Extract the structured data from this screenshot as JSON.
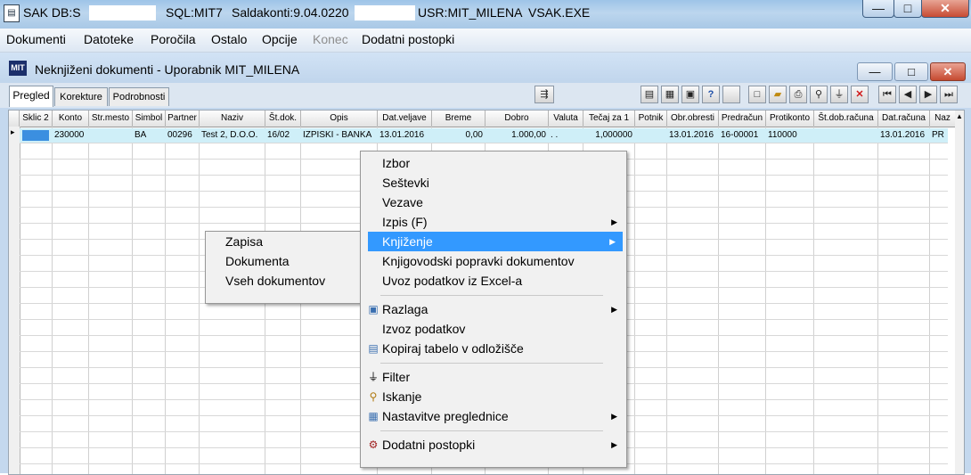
{
  "window": {
    "title_prefix": "SAK   DB:S",
    "title_sql": "SQL:MIT7",
    "title_saldo": "Saldakonti:9.04.0220",
    "title_usr": "USR:MIT_MILENA",
    "title_exe": "VSAK.EXE",
    "minimize": "—",
    "maximize": "□",
    "close": "✕"
  },
  "menubar": [
    "Dokumenti",
    "Datoteke",
    "Poročila",
    "Ostalo",
    "Opcije",
    "Konec",
    "Dodatni postopki"
  ],
  "inner_window": {
    "icon_text": "MIT",
    "title": "Neknjiženi dokumenti - Uporabnik MIT_MILENA"
  },
  "tabs": [
    "Pregled",
    "Korekture",
    "Podrobnosti"
  ],
  "grid": {
    "columns": [
      "Sklic 2",
      "Konto",
      "Str.mesto",
      "Simbol",
      "Partner",
      "Naziv",
      "Št.dok.",
      "Opis",
      "Dat.veljave",
      "Breme",
      "Dobro",
      "Valuta",
      "Tečaj za 1",
      "Potnik",
      "Obr.obresti",
      "Predračun",
      "Protikonto",
      "Št.dob.računa",
      "Dat.računa",
      "Naz"
    ],
    "row": [
      "",
      "230000",
      "",
      "BA",
      "00296",
      "Test 2, D.O.O.",
      "16/02",
      "IZPISKI - BANKA",
      "13.01.2016",
      "0,00",
      "1.000,00",
      ". .",
      "1,000000",
      "",
      "13.01.2016",
      "16-00001",
      "110000",
      "",
      "13.01.2016",
      "PR"
    ],
    "row_indicator": "▸"
  },
  "context_menu": {
    "items": [
      {
        "label": "Izbor",
        "arrow": false,
        "icon": ""
      },
      {
        "label": "Seštevki",
        "arrow": false,
        "icon": ""
      },
      {
        "label": "Vezave",
        "arrow": false,
        "icon": ""
      },
      {
        "label": "Izpis (F)",
        "arrow": true,
        "icon": ""
      },
      {
        "label": "Knjiženje",
        "arrow": true,
        "icon": "",
        "highlighted": true
      },
      {
        "label": "Knjigovodski popravki dokumentov",
        "arrow": false,
        "icon": ""
      },
      {
        "label": "Uvoz podatkov iz Excel-a",
        "arrow": false,
        "icon": ""
      },
      {
        "label": "Razlaga",
        "arrow": true,
        "icon": "razlaga-icon"
      },
      {
        "label": "Izvoz podatkov",
        "arrow": false,
        "icon": ""
      },
      {
        "label": "Kopiraj tabelo v odložišče",
        "arrow": false,
        "icon": "clipboard-icon"
      },
      {
        "label": "Filter",
        "arrow": false,
        "icon": "filter-icon"
      },
      {
        "label": "Iskanje",
        "arrow": false,
        "icon": "search-icon"
      },
      {
        "label": "Nastavitve preglednice",
        "arrow": true,
        "icon": "settings-icon"
      },
      {
        "label": "Dodatni postopki",
        "arrow": true,
        "icon": "gears-icon"
      }
    ]
  },
  "submenu": {
    "items": [
      "Zapisa",
      "Dokumenta",
      "Vseh dokumentov"
    ]
  }
}
